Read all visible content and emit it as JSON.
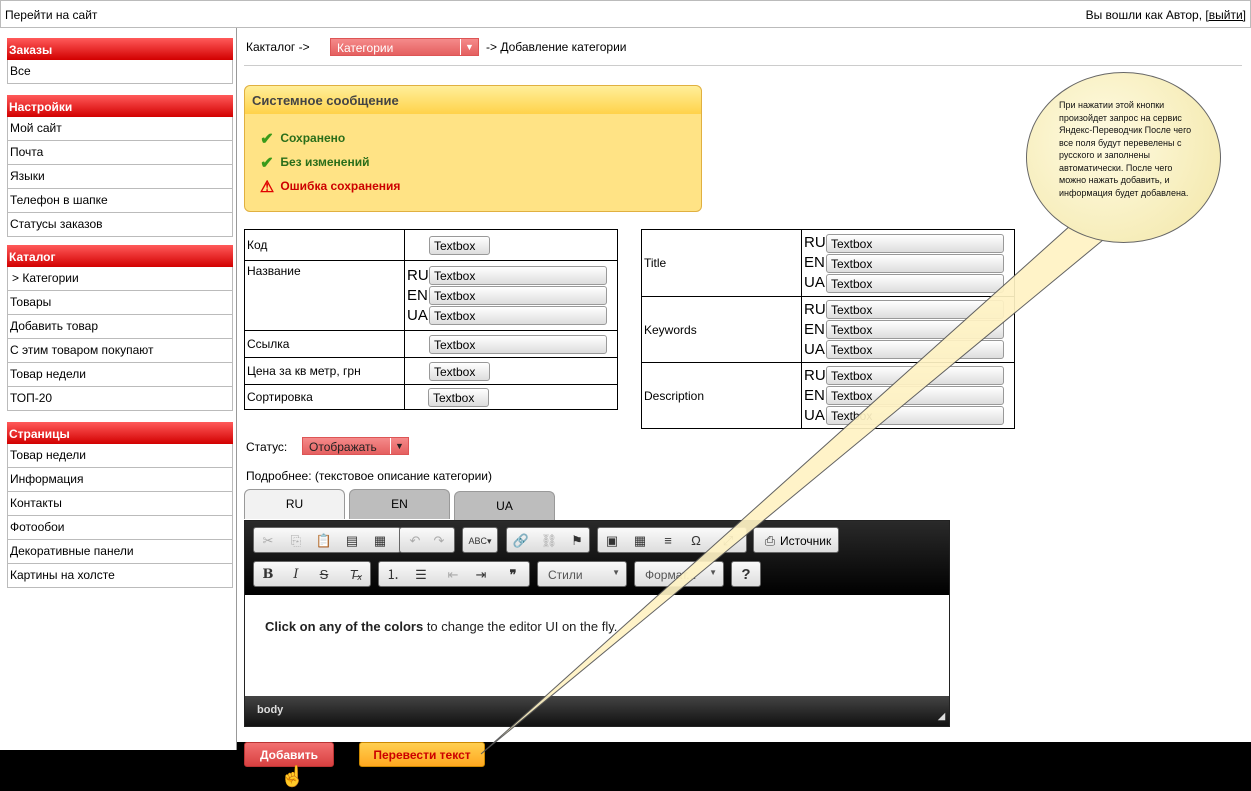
{
  "topbar": {
    "goto_site": "Перейти на сайт",
    "logged_in": "Вы вошли как Автор,",
    "logout": "[выйти]"
  },
  "sidebar": {
    "sections": [
      {
        "header": "Заказы",
        "items": [
          "Все"
        ]
      },
      {
        "header": "Настройки",
        "items": [
          "Мой сайт",
          "Почта",
          "Языки",
          "Телефон в шапке",
          "Статусы заказов"
        ]
      },
      {
        "header": "Каталог",
        "items": [
          "> Категории",
          "Товары",
          "Добавить товар",
          "С этим товаром покупают",
          "Товар недели",
          "ТОП-20"
        ]
      },
      {
        "header": "Страницы",
        "items": [
          "Товар недели",
          "Информация",
          "Контакты",
          "Фотообои",
          "Декоративные панели",
          "Картины на холсте"
        ]
      }
    ]
  },
  "breadcrumb": {
    "prefix": "Какталог ->",
    "select_value": "Категории",
    "suffix": "-> Добавление категории"
  },
  "message_box": {
    "title": "Системное сообщение",
    "saved": "Сохранено",
    "no_changes": "Без изменений",
    "error": "Ошибка сохранения"
  },
  "form_left": {
    "code_label": "Код",
    "name_label": "Название",
    "link_label": "Ссылка",
    "price_label": "Цена за кв метр, грн",
    "sort_label": "Сортировка",
    "textbox": "Textbox"
  },
  "form_right": {
    "title_label": "Title",
    "keywords_label": "Keywords",
    "description_label": "Description",
    "textbox": "Textbox"
  },
  "langs": [
    "RU",
    "EN",
    "UA"
  ],
  "status": {
    "label": "Статус:",
    "value": "Отображать"
  },
  "details_label": "Подробнее: (текстовое описание  категории)",
  "tabs": [
    "RU",
    "EN",
    "UA"
  ],
  "editor": {
    "source_label": "Источник",
    "styles_label": "Стили",
    "format_label": "Формат...",
    "help_label": "?",
    "content_bold": "Click on any of the colors",
    "content_rest": " to change the editor UI on the fly.",
    "footer_path": "body"
  },
  "buttons": {
    "add": "Добавить",
    "translate": "Перевести текст"
  },
  "tooltip": {
    "text": "При нажатии этой кнопки произойдет запрос на сервис Яндекс-Переводчик После чего все поля будут перевелены с русского и заполнены автоматически. После чего можно нажать добавить, и информация будет добавлена."
  },
  "colors": {
    "sidebar_header": "#d20000",
    "message_bg": "#ffe385",
    "add_button": "#e85050",
    "translate_button": "#ffb830",
    "success": "#2a6e1a",
    "error": "#cc0000"
  },
  "icons": [
    "check-icon",
    "warning-icon",
    "cut-icon",
    "copy-icon",
    "paste-icon",
    "paste-text-icon",
    "paste-word-icon",
    "undo-icon",
    "redo-icon",
    "spellcheck-icon",
    "link-icon",
    "unlink-icon",
    "anchor-icon",
    "image-icon",
    "table-icon",
    "hr-icon",
    "special-char-icon",
    "maximize-icon",
    "source-icon",
    "bold-icon",
    "italic-icon",
    "strike-icon",
    "remove-format-icon",
    "numbered-list-icon",
    "bulleted-list-icon",
    "outdent-icon",
    "indent-icon",
    "blockquote-icon",
    "hand-cursor-icon"
  ]
}
